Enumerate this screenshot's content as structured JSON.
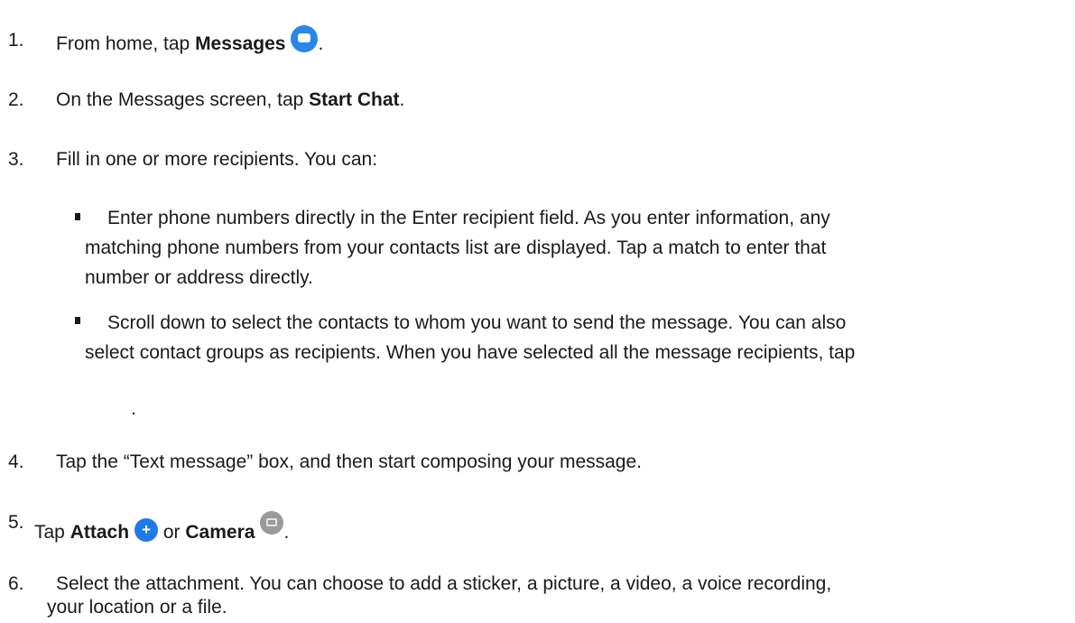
{
  "steps": {
    "s1": {
      "num": "1.",
      "text": "From home, tap ",
      "bold": "Messages",
      "after": ".",
      "icon": "messages-icon"
    },
    "s2": {
      "num": "2.",
      "text": "On the Messages screen, tap ",
      "bold": "Start Chat",
      "after": "."
    },
    "s3": {
      "num": "3.",
      "text": "Fill in one or more recipients. You can:"
    },
    "b1": {
      "line1": "Enter phone numbers directly in the Enter recipient field. As you enter information, any",
      "line2": "matching phone numbers from your contacts list are displayed. Tap a match to enter that",
      "line3": "number or address directly."
    },
    "b2": {
      "line1": "Scroll down to select the contacts to whom you want to send the message. You can also",
      "line2": "select  contact groups as recipients. When you have selected all the message recipients, tap",
      "line3": "."
    },
    "s4": {
      "num": "4.",
      "text": "Tap the “Text message” box, and then start composing your message."
    },
    "s5": {
      "num": "5.",
      "pre": "Tap ",
      "bold1": "Attach",
      "mid": " or ",
      "bold2": "Camera",
      "after": ".",
      "icon1": "plus-icon",
      "icon2": "camera-icon"
    },
    "s6": {
      "num": "6.",
      "line1": "Select the attachment. You can choose to add a sticker, a picture, a video, a voice recording,",
      "line2": "your location or a file."
    }
  }
}
